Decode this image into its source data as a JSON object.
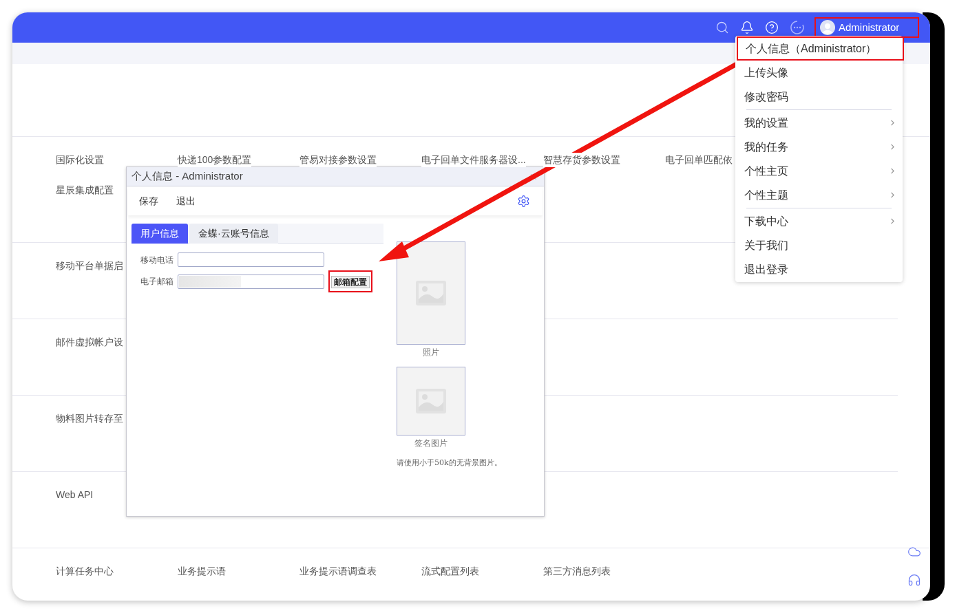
{
  "top_bar": {
    "user": {
      "name": "Administrator",
      "highlighted": true
    }
  },
  "sections": [
    {
      "rows": [
        [
          "国际化设置",
          "快递100参数配置",
          "管易对接参数设置",
          "电子回单文件服务器设...",
          "智慧存货参数设置",
          "电子回单匹配依"
        ],
        [
          "星辰集成配置"
        ]
      ]
    },
    {
      "rows": [
        [
          "移动平台单据启"
        ]
      ]
    },
    {
      "rows": [
        [
          "邮件虚拟帐户设"
        ]
      ]
    },
    {
      "rows": [
        [
          "物料图片转存至"
        ]
      ]
    },
    {
      "rows": [
        [
          "Web API"
        ]
      ]
    },
    {
      "rows": [
        [
          "计算任务中心",
          "业务提示语",
          "业务提示语调查表",
          "流式配置列表",
          "第三方消息列表"
        ]
      ]
    }
  ],
  "user_menu": {
    "items": [
      {
        "label": "个人信息（Administrator）",
        "submenu": false,
        "highlighted": true,
        "divider_after": false
      },
      {
        "label": "上传头像",
        "submenu": false,
        "highlighted": false,
        "divider_after": false
      },
      {
        "label": "修改密码",
        "submenu": false,
        "highlighted": false,
        "divider_after": true
      },
      {
        "label": "我的设置",
        "submenu": true,
        "highlighted": false,
        "divider_after": false
      },
      {
        "label": "我的任务",
        "submenu": true,
        "highlighted": false,
        "divider_after": false
      },
      {
        "label": "个性主页",
        "submenu": true,
        "highlighted": false,
        "divider_after": false
      },
      {
        "label": "个性主题",
        "submenu": true,
        "highlighted": false,
        "divider_after": true
      },
      {
        "label": "下载中心",
        "submenu": true,
        "highlighted": false,
        "divider_after": false
      },
      {
        "label": "关于我们",
        "submenu": false,
        "highlighted": false,
        "divider_after": false
      },
      {
        "label": "退出登录",
        "submenu": false,
        "highlighted": false,
        "divider_after": false
      }
    ]
  },
  "dialog": {
    "title": "个人信息 - Administrator",
    "toolbar": [
      "保存",
      "退出"
    ],
    "tabs": [
      {
        "label": "用户信息",
        "selected": true
      },
      {
        "label": "金蝶·云账号信息",
        "selected": false
      }
    ],
    "fields": [
      {
        "label": "移动电话",
        "blurred": false
      },
      {
        "label": "电子邮箱",
        "blurred": true,
        "button": "邮箱配置",
        "button_highlighted": true
      }
    ],
    "images": [
      {
        "caption": "照片"
      },
      {
        "caption": "签名图片"
      }
    ],
    "hint": "请使用小于50k的无背景图片。"
  }
}
